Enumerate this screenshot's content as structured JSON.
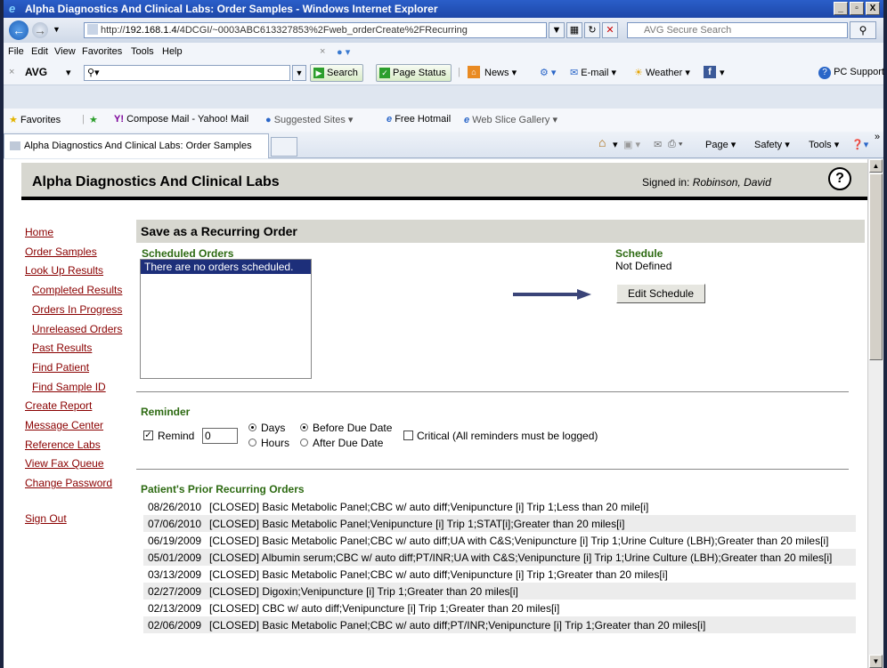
{
  "window": {
    "title": "Alpha Diagnostics And Clinical Labs: Order Samples - Windows Internet Explorer",
    "minimize": "_",
    "restore": "▫",
    "close": "X"
  },
  "address_bar": {
    "url_prefix": "http://",
    "url_host": "192.168.1.4",
    "url_path": "/4DCGI/~0003ABC613327853%2Fweb_orderCreate%2FRecurring",
    "search_placeholder": "AVG Secure Search"
  },
  "menu": [
    "File",
    "Edit",
    "View",
    "Favorites",
    "Tools",
    "Help"
  ],
  "avg_toolbar": {
    "logo": "AVG",
    "search_label": "Search",
    "page_status_label": "Page Status",
    "news_label": "News",
    "email_label": "E-mail",
    "weather_label": "Weather",
    "pc_support_label": "PC Support"
  },
  "favorites_bar": {
    "favorites_label": "Favorites",
    "items": [
      "Compose Mail - Yahoo! Mail",
      "Suggested Sites",
      "Free Hotmail",
      "Web Slice Gallery"
    ]
  },
  "tab": {
    "label": "Alpha Diagnostics And Clinical Labs: Order Samples"
  },
  "command_bar": {
    "page_label": "Page",
    "safety_label": "Safety",
    "tools_label": "Tools"
  },
  "header": {
    "brand": "Alpha Diagnostics And Clinical Labs",
    "signed_in_prefix": "Signed in:",
    "user": "Robinson, David",
    "help_icon": "?"
  },
  "sidebar": {
    "items": [
      {
        "label": "Home"
      },
      {
        "label": "Order Samples"
      },
      {
        "label": "Look Up Results"
      },
      {
        "label": "Completed Results"
      },
      {
        "label": "Orders In Progress"
      },
      {
        "label": "Unreleased Orders"
      },
      {
        "label": "Past Results"
      },
      {
        "label": "Find Patient"
      },
      {
        "label": "Find Sample ID"
      },
      {
        "label": "Create Report"
      },
      {
        "label": "Message Center"
      },
      {
        "label": "Reference Labs"
      },
      {
        "label": "View Fax Queue"
      },
      {
        "label": "Change Password"
      },
      {
        "label": "Sign Out"
      }
    ]
  },
  "main": {
    "section_title": "Save as a Recurring Order",
    "scheduled_orders_title": "Scheduled Orders",
    "scheduled_orders_empty": "There are no orders scheduled.",
    "schedule_title": "Schedule",
    "schedule_value": "Not Defined",
    "edit_schedule_label": "Edit Schedule",
    "reminder": {
      "title": "Reminder",
      "remind_label": "Remind",
      "remind_value": "0",
      "days_label": "Days",
      "hours_label": "Hours",
      "before_label": "Before Due Date",
      "after_label": "After Due Date",
      "critical_label": "Critical (All reminders must be logged)"
    },
    "prior_title": "Patient's Prior Recurring Orders",
    "prior_orders": [
      {
        "date": "08/26/2010",
        "text": "[CLOSED] Basic Metabolic Panel;CBC w/ auto diff;Venipuncture [i] Trip 1;Less than 20 mile[i]"
      },
      {
        "date": "07/06/2010",
        "text": "[CLOSED] Basic Metabolic Panel;Venipuncture [i] Trip 1;STAT[i];Greater than 20 miles[i]"
      },
      {
        "date": "06/19/2009",
        "text": "[CLOSED] Basic Metabolic Panel;CBC w/ auto diff;UA with C&S;Venipuncture [i] Trip 1;Urine Culture (LBH);Greater than 20 miles[i]"
      },
      {
        "date": "05/01/2009",
        "text": "[CLOSED] Albumin serum;CBC w/ auto diff;PT/INR;UA with C&S;Venipuncture [i] Trip 1;Urine Culture (LBH);Greater than 20 miles[i]"
      },
      {
        "date": "03/13/2009",
        "text": "[CLOSED] Basic Metabolic Panel;CBC w/ auto diff;Venipuncture [i] Trip 1;Greater than 20 miles[i]"
      },
      {
        "date": "02/27/2009",
        "text": "[CLOSED] Digoxin;Venipuncture [i] Trip 1;Greater than 20 miles[i]"
      },
      {
        "date": "02/13/2009",
        "text": "[CLOSED] CBC w/ auto diff;Venipuncture [i] Trip 1;Greater than 20 miles[i]"
      },
      {
        "date": "02/06/2009",
        "text": "[CLOSED] Basic Metabolic Panel;CBC w/ auto diff;PT/INR;Venipuncture [i] Trip 1;Greater than 20 miles[i]"
      }
    ]
  }
}
